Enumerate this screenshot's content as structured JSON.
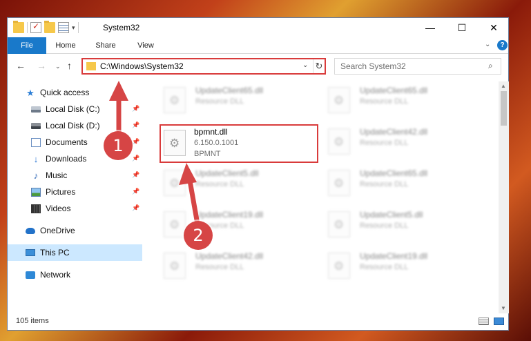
{
  "window": {
    "title": "System32",
    "controls": {
      "minimize": "—",
      "maximize": "☐",
      "close": "✕"
    }
  },
  "ribbon": {
    "tabs": [
      "File",
      "Home",
      "Share",
      "View"
    ],
    "help": "?"
  },
  "nav": {
    "back": "←",
    "forward": "→",
    "recent": "⌄",
    "up": "↑",
    "address": "C:\\Windows\\System32",
    "address_dropdown": "⌄",
    "refresh": "↻",
    "search_placeholder": "Search System32",
    "search_icon": "⌕"
  },
  "sidebar": {
    "items": [
      {
        "label": "Quick access",
        "icon": "star-icon"
      },
      {
        "label": "Local Disk (C:)",
        "icon": "drive-icon",
        "pinned": true
      },
      {
        "label": "Local Disk (D:)",
        "icon": "drive-icon",
        "pinned": true
      },
      {
        "label": "Documents",
        "icon": "documents-icon",
        "pinned": true
      },
      {
        "label": "Downloads",
        "icon": "download-icon",
        "pinned": true
      },
      {
        "label": "Music",
        "icon": "music-icon",
        "pinned": true
      },
      {
        "label": "Pictures",
        "icon": "pictures-icon",
        "pinned": true
      },
      {
        "label": "Videos",
        "icon": "videos-icon",
        "pinned": true
      },
      {
        "label": "OneDrive",
        "icon": "cloud-icon"
      },
      {
        "label": "This PC",
        "icon": "computer-icon",
        "selected": true
      },
      {
        "label": "Network",
        "icon": "network-icon"
      }
    ]
  },
  "files": [
    {
      "name": "UpdateClient65.dll",
      "type": "Resource DLL"
    },
    {
      "name": "UpdateClient65.dll",
      "type": "Resource DLL"
    },
    {
      "name": "bpmnt.dll",
      "type": "6.150.0.1001",
      "extra": "BPMNT",
      "highlighted": true
    },
    {
      "name": "UpdateClient42.dll",
      "type": "Resource DLL"
    },
    {
      "name": "UpdateClient5.dll",
      "type": "Resource DLL"
    },
    {
      "name": "UpdateClient65.dll",
      "type": "Resource DLL"
    },
    {
      "name": "UpdateClient19.dll",
      "type": "Resource DLL"
    },
    {
      "name": "UpdateClient5.dll",
      "type": "Resource DLL"
    },
    {
      "name": "UpdateClient42.dll",
      "type": "Resource DLL"
    },
    {
      "name": "UpdateClient19.dll",
      "type": "Resource DLL"
    }
  ],
  "status": {
    "count": "105 items"
  },
  "annotations": {
    "step1": "1",
    "step2": "2",
    "highlight_color": "#d93b3b",
    "badge_color": "#d64545"
  },
  "colors": {
    "file_tab": "#1979ca",
    "selected": "#cce8ff"
  }
}
